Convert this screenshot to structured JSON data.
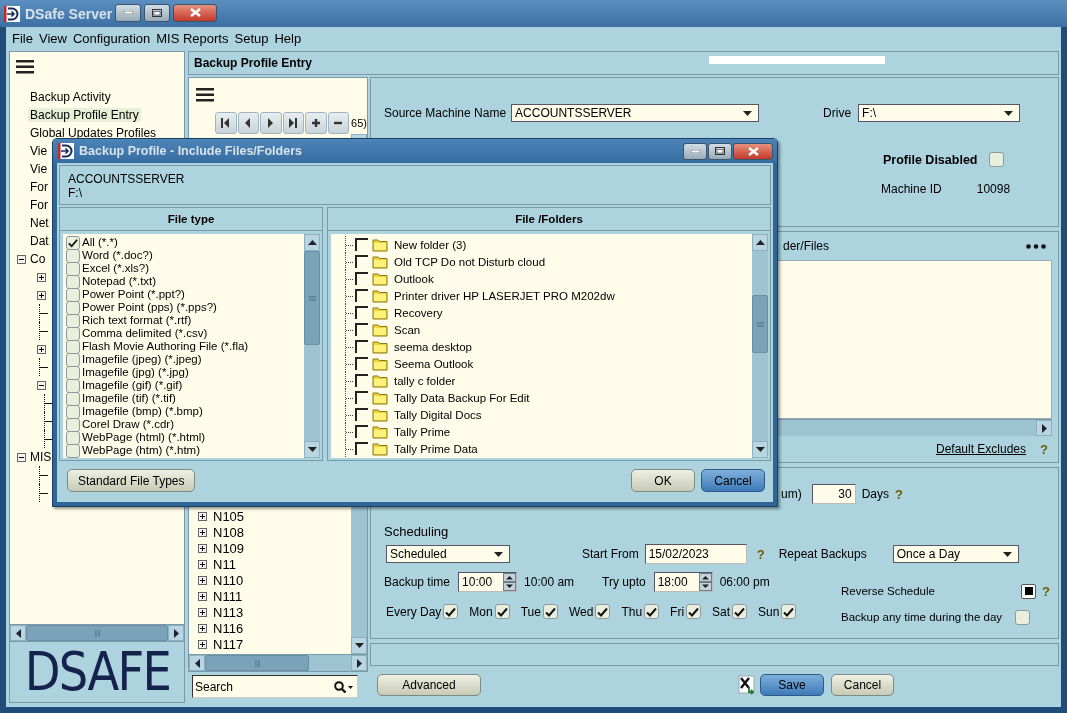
{
  "window": {
    "title": "DSafe Server"
  },
  "menu": [
    "File",
    "View",
    "Configuration",
    "MIS Reports",
    "Setup",
    "Help"
  ],
  "sidebar": {
    "items": [
      {
        "label": "Backup Activity",
        "selected": false
      },
      {
        "label": "Backup Profile Entry",
        "selected": true
      },
      {
        "label": "Global Updates Profiles",
        "selected": false
      },
      {
        "label": "Vie",
        "selected": false
      },
      {
        "label": "Vie",
        "selected": false
      },
      {
        "label": "For",
        "selected": false
      },
      {
        "label": "For",
        "selected": false
      },
      {
        "label": "Net",
        "selected": false
      },
      {
        "label": "Dat",
        "selected": false
      },
      {
        "label": "Co",
        "selected": false,
        "expanded": true,
        "children": [
          {
            "kind": "node",
            "expanded": false
          },
          {
            "kind": "node",
            "expanded": false
          },
          {
            "kind": "leaf"
          },
          {
            "kind": "leaf"
          },
          {
            "kind": "node",
            "expanded": false
          },
          {
            "kind": "leaf"
          },
          {
            "kind": "node",
            "expanded": true,
            "children": [
              {
                "kind": "leaf"
              },
              {
                "kind": "leaf"
              },
              {
                "kind": "leaf"
              }
            ]
          }
        ]
      },
      {
        "label": "MIS",
        "selected": false,
        "expanded": true,
        "children": [
          {
            "kind": "leaf"
          },
          {
            "kind": "leaf"
          }
        ]
      }
    ],
    "logo": "DSAFE"
  },
  "page_title": "Backup Profile Entry",
  "profiles": {
    "record_count": "65)",
    "items": [
      {
        "label": "N105",
        "expanded": false
      },
      {
        "label": "N108",
        "expanded": false
      },
      {
        "label": "N109",
        "expanded": false
      },
      {
        "label": "N11",
        "expanded": false
      },
      {
        "label": "N110",
        "expanded": false
      },
      {
        "label": "N111",
        "expanded": false
      },
      {
        "label": "N113",
        "expanded": false
      },
      {
        "label": "N116",
        "expanded": false
      },
      {
        "label": "N117",
        "expanded": false
      }
    ],
    "search": {
      "placeholder": "Search"
    }
  },
  "form": {
    "source_machine": {
      "label": "Source Machine Name",
      "value": "ACCOUNTSSERVER"
    },
    "drive": {
      "label": "Drive",
      "value": "F:\\"
    },
    "profile_disabled": {
      "label": "Profile Disabled",
      "checked": false
    },
    "machine_id": {
      "label": "Machine ID",
      "value": "10098"
    },
    "folders": {
      "label": "der/Files"
    },
    "default_excludes": {
      "label": "Default Excludes",
      "help": "?"
    },
    "retention": {
      "label": "um)",
      "value": "30",
      "unit": "Days",
      "help": "?"
    },
    "scheduling": {
      "title": "Scheduling",
      "mode": "Scheduled",
      "start_from": {
        "label": "Start From",
        "value": "15/02/2023",
        "help": "?"
      },
      "repeat": {
        "label": "Repeat Backups",
        "value": "Once a Day"
      },
      "backup_time": {
        "label": "Backup time",
        "value": "10:00",
        "reading": "10:00 am"
      },
      "try_upto": {
        "label": "Try upto",
        "value": "18:00",
        "reading": "06:00 pm"
      },
      "days": [
        {
          "label": "Every Day",
          "checked": true
        },
        {
          "label": "Mon",
          "checked": true
        },
        {
          "label": "Tue",
          "checked": true
        },
        {
          "label": "Wed",
          "checked": true
        },
        {
          "label": "Thu",
          "checked": true
        },
        {
          "label": "Fri",
          "checked": true
        },
        {
          "label": "Sat",
          "checked": true
        },
        {
          "label": "Sun",
          "checked": true
        }
      ],
      "reverse_schedule": {
        "label": "Reverse Schedule",
        "checked": true,
        "help": "?"
      },
      "any_time": {
        "label": "Backup any time during the day",
        "checked": false
      }
    },
    "buttons": {
      "advanced": "Advanced",
      "save": "Save",
      "cancel": "Cancel"
    }
  },
  "dialog": {
    "title": "Backup Profile - Include Files/Folders",
    "machine": "ACCOUNTSSERVER",
    "drive": "F:\\",
    "file_types": {
      "header": "File type",
      "items": [
        {
          "label": "All (*.*)",
          "checked": true
        },
        {
          "label": "Word (*.doc?)",
          "checked": false
        },
        {
          "label": "Excel (*.xls?)",
          "checked": false
        },
        {
          "label": "Notepad (*.txt)",
          "checked": false
        },
        {
          "label": "Power Point (*.ppt?)",
          "checked": false
        },
        {
          "label": "Power Point (pps) (*.pps?)",
          "checked": false
        },
        {
          "label": "Rich text format (*.rtf)",
          "checked": false
        },
        {
          "label": "Comma delimited (*.csv)",
          "checked": false
        },
        {
          "label": "Flash Movie Authoring File (*.fla)",
          "checked": false
        },
        {
          "label": "Imagefile (jpeg) (*.jpeg)",
          "checked": false
        },
        {
          "label": "Imagefile (jpg) (*.jpg)",
          "checked": false
        },
        {
          "label": "Imagefile (gif) (*.gif)",
          "checked": false
        },
        {
          "label": "Imagefile (tif) (*.tif)",
          "checked": false
        },
        {
          "label": "Imagefile (bmp) (*.bmp)",
          "checked": false
        },
        {
          "label": "Corel Draw (*.cdr)",
          "checked": false
        },
        {
          "label": "WebPage (html) (*.html)",
          "checked": false
        },
        {
          "label": "WebPage (htm) (*.htm)",
          "checked": false
        }
      ]
    },
    "folders": {
      "header": "File /Folders",
      "items": [
        {
          "label": "New folder (3)",
          "checked": false
        },
        {
          "label": "Old TCP Do not Disturb cloud",
          "checked": false
        },
        {
          "label": "Outlook",
          "checked": false
        },
        {
          "label": "Printer driver HP LASERJET PRO M202dw",
          "checked": false
        },
        {
          "label": "Recovery",
          "checked": false
        },
        {
          "label": "Scan",
          "checked": false
        },
        {
          "label": "seema desktop",
          "checked": false
        },
        {
          "label": "Seema Outlook",
          "checked": false
        },
        {
          "label": "tally c folder",
          "checked": false
        },
        {
          "label": "Tally Data Backup For Edit",
          "checked": false
        },
        {
          "label": "Tally Digital Docs",
          "checked": false
        },
        {
          "label": "Tally Prime",
          "checked": false
        },
        {
          "label": "Tally Prime Data",
          "checked": false
        }
      ]
    },
    "buttons": {
      "standard": "Standard File Types",
      "ok": "OK",
      "cancel": "Cancel"
    }
  }
}
